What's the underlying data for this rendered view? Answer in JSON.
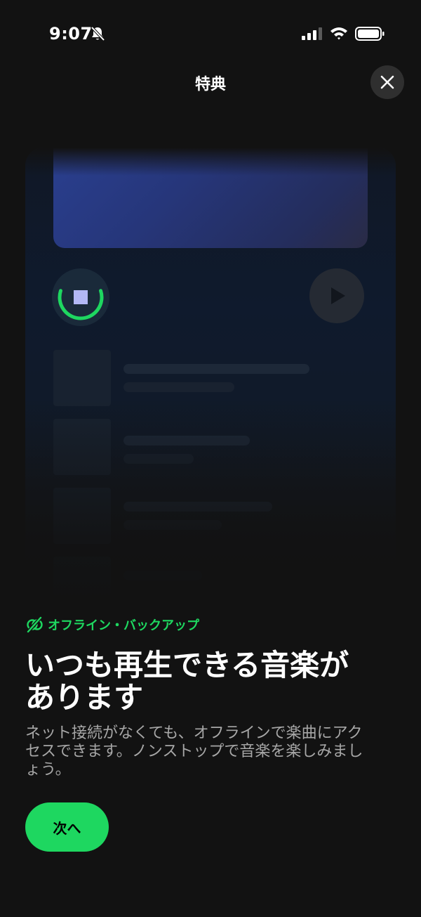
{
  "status_bar": {
    "time": "9:07",
    "icons": [
      "bell-muted-icon",
      "cellular-signal-icon",
      "wifi-icon",
      "battery-icon"
    ]
  },
  "header": {
    "title": "特典",
    "close_icon": "close-icon"
  },
  "illustration": {
    "download_progress": 0.6,
    "icons": [
      "download-stop-icon",
      "play-icon"
    ]
  },
  "feature": {
    "icon": "offline-icon",
    "label": "オフライン・バックアップ"
  },
  "headline": {
    "line1": "いつも再生できる音楽が",
    "line2": "あります"
  },
  "body": {
    "line1": "ネット接続がなくても、オフラインで楽曲にアク",
    "line2": "セスできます。ノンストップで音楽を楽しみまし",
    "line3": "ょう。"
  },
  "actions": {
    "next_label": "次へ"
  },
  "colors": {
    "background": "#121212",
    "accent": "#1ed760",
    "secondary_text": "#a7a7a7",
    "close_bg": "#2f2f2f"
  }
}
